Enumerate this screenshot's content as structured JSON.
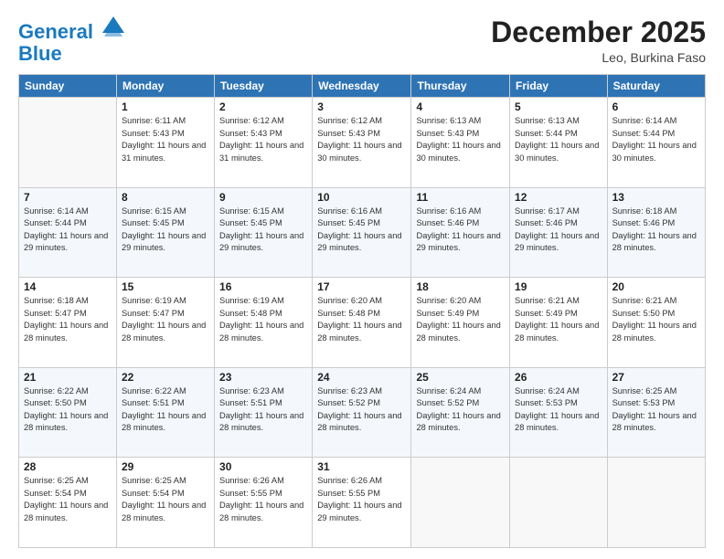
{
  "logo": {
    "line1": "General",
    "line2": "Blue"
  },
  "title": "December 2025",
  "location": "Leo, Burkina Faso",
  "days_header": [
    "Sunday",
    "Monday",
    "Tuesday",
    "Wednesday",
    "Thursday",
    "Friday",
    "Saturday"
  ],
  "weeks": [
    [
      {
        "num": "",
        "empty": true
      },
      {
        "num": "1",
        "sunrise": "6:11 AM",
        "sunset": "5:43 PM",
        "daylight": "11 hours and 31 minutes."
      },
      {
        "num": "2",
        "sunrise": "6:12 AM",
        "sunset": "5:43 PM",
        "daylight": "11 hours and 31 minutes."
      },
      {
        "num": "3",
        "sunrise": "6:12 AM",
        "sunset": "5:43 PM",
        "daylight": "11 hours and 30 minutes."
      },
      {
        "num": "4",
        "sunrise": "6:13 AM",
        "sunset": "5:43 PM",
        "daylight": "11 hours and 30 minutes."
      },
      {
        "num": "5",
        "sunrise": "6:13 AM",
        "sunset": "5:44 PM",
        "daylight": "11 hours and 30 minutes."
      },
      {
        "num": "6",
        "sunrise": "6:14 AM",
        "sunset": "5:44 PM",
        "daylight": "11 hours and 30 minutes."
      }
    ],
    [
      {
        "num": "7",
        "sunrise": "6:14 AM",
        "sunset": "5:44 PM",
        "daylight": "11 hours and 29 minutes."
      },
      {
        "num": "8",
        "sunrise": "6:15 AM",
        "sunset": "5:45 PM",
        "daylight": "11 hours and 29 minutes."
      },
      {
        "num": "9",
        "sunrise": "6:15 AM",
        "sunset": "5:45 PM",
        "daylight": "11 hours and 29 minutes."
      },
      {
        "num": "10",
        "sunrise": "6:16 AM",
        "sunset": "5:45 PM",
        "daylight": "11 hours and 29 minutes."
      },
      {
        "num": "11",
        "sunrise": "6:16 AM",
        "sunset": "5:46 PM",
        "daylight": "11 hours and 29 minutes."
      },
      {
        "num": "12",
        "sunrise": "6:17 AM",
        "sunset": "5:46 PM",
        "daylight": "11 hours and 29 minutes."
      },
      {
        "num": "13",
        "sunrise": "6:18 AM",
        "sunset": "5:46 PM",
        "daylight": "11 hours and 28 minutes."
      }
    ],
    [
      {
        "num": "14",
        "sunrise": "6:18 AM",
        "sunset": "5:47 PM",
        "daylight": "11 hours and 28 minutes."
      },
      {
        "num": "15",
        "sunrise": "6:19 AM",
        "sunset": "5:47 PM",
        "daylight": "11 hours and 28 minutes."
      },
      {
        "num": "16",
        "sunrise": "6:19 AM",
        "sunset": "5:48 PM",
        "daylight": "11 hours and 28 minutes."
      },
      {
        "num": "17",
        "sunrise": "6:20 AM",
        "sunset": "5:48 PM",
        "daylight": "11 hours and 28 minutes."
      },
      {
        "num": "18",
        "sunrise": "6:20 AM",
        "sunset": "5:49 PM",
        "daylight": "11 hours and 28 minutes."
      },
      {
        "num": "19",
        "sunrise": "6:21 AM",
        "sunset": "5:49 PM",
        "daylight": "11 hours and 28 minutes."
      },
      {
        "num": "20",
        "sunrise": "6:21 AM",
        "sunset": "5:50 PM",
        "daylight": "11 hours and 28 minutes."
      }
    ],
    [
      {
        "num": "21",
        "sunrise": "6:22 AM",
        "sunset": "5:50 PM",
        "daylight": "11 hours and 28 minutes."
      },
      {
        "num": "22",
        "sunrise": "6:22 AM",
        "sunset": "5:51 PM",
        "daylight": "11 hours and 28 minutes."
      },
      {
        "num": "23",
        "sunrise": "6:23 AM",
        "sunset": "5:51 PM",
        "daylight": "11 hours and 28 minutes."
      },
      {
        "num": "24",
        "sunrise": "6:23 AM",
        "sunset": "5:52 PM",
        "daylight": "11 hours and 28 minutes."
      },
      {
        "num": "25",
        "sunrise": "6:24 AM",
        "sunset": "5:52 PM",
        "daylight": "11 hours and 28 minutes."
      },
      {
        "num": "26",
        "sunrise": "6:24 AM",
        "sunset": "5:53 PM",
        "daylight": "11 hours and 28 minutes."
      },
      {
        "num": "27",
        "sunrise": "6:25 AM",
        "sunset": "5:53 PM",
        "daylight": "11 hours and 28 minutes."
      }
    ],
    [
      {
        "num": "28",
        "sunrise": "6:25 AM",
        "sunset": "5:54 PM",
        "daylight": "11 hours and 28 minutes."
      },
      {
        "num": "29",
        "sunrise": "6:25 AM",
        "sunset": "5:54 PM",
        "daylight": "11 hours and 28 minutes."
      },
      {
        "num": "30",
        "sunrise": "6:26 AM",
        "sunset": "5:55 PM",
        "daylight": "11 hours and 28 minutes."
      },
      {
        "num": "31",
        "sunrise": "6:26 AM",
        "sunset": "5:55 PM",
        "daylight": "11 hours and 29 minutes."
      },
      {
        "num": "",
        "empty": true
      },
      {
        "num": "",
        "empty": true
      },
      {
        "num": "",
        "empty": true
      }
    ]
  ]
}
